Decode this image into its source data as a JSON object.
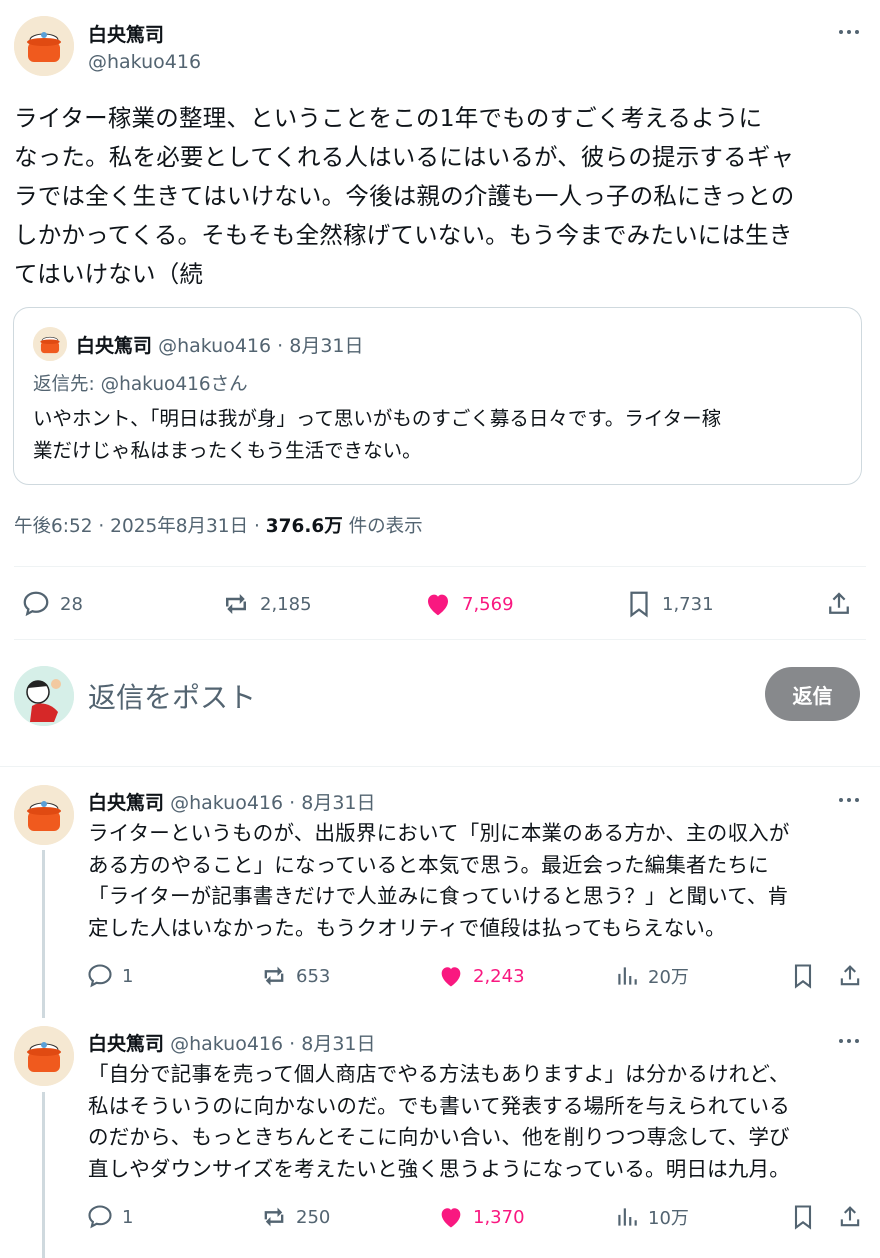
{
  "colors": {
    "like": "#f91880",
    "muted": "#536471",
    "border": "#cfd9de",
    "reply_button_bg": "#87898c"
  },
  "main_post": {
    "author_name": "白央篤司",
    "author_handle": "@hakuo416",
    "text_lines": [
      "ライター稼業の整理、ということをこの1年でものすごく考えるように",
      "なった。私を必要としてくれる人はいるにはいるが、彼らの提示するギャ",
      "ラでは全く生きてはいけない。今後は親の介護も一人っ子の私にきっとの",
      "しかかってくる。そもそも全然稼げていない。もう今までみたいには生き",
      "てはいけない（続"
    ],
    "quote": {
      "author_name": "白央篤司",
      "author_handle": "@hakuo416",
      "date": "· 8月31日",
      "reply_to": "返信先: @hakuo416さん",
      "text_lines": [
        "いやホント、「明日は我が身」って思いがものすごく募る日々です。ライター稼",
        "業だけじゃ私はまったくもう生活できない。"
      ]
    },
    "meta_time": "午後6:52 · 2025年8月31日 · ",
    "meta_views": "376.6万",
    "meta_views_label": " 件の表示",
    "actions": {
      "replies": "28",
      "reposts": "2,185",
      "likes": "7,569",
      "bookmarks": "1,731"
    }
  },
  "compose": {
    "placeholder": "返信をポスト",
    "button_label": "返信"
  },
  "replies": [
    {
      "author_name": "白央篤司",
      "author_handle": "@hakuo416",
      "date": "· 8月31日",
      "text_lines": [
        "ライターというものが、出版界において「別に本業のある方か、主の収入が",
        "ある方のやること」になっていると本気で思う。最近会った編集者たちに",
        "「ライターが記事書きだけで人並みに食っていけると思う？」と聞いて、肯",
        "定した人はいなかった。もうクオリティで値段は払ってもらえない。"
      ],
      "actions": {
        "replies": "1",
        "reposts": "653",
        "likes": "2,243",
        "views": "20万"
      }
    },
    {
      "author_name": "白央篤司",
      "author_handle": "@hakuo416",
      "date": "· 8月31日",
      "text_lines": [
        "「自分で記事を売って個人商店でやる方法もありますよ」は分かるけれど、",
        "私はそういうのに向かないのだ。でも書いて発表する場所を与えられている",
        "のだから、もっときちんとそこに向かい合い、他を削りつつ専念して、学び",
        "直しやダウンサイズを考えたいと強く思うようになっている。明日は九月。"
      ],
      "actions": {
        "replies": "1",
        "reposts": "250",
        "likes": "1,370",
        "views": "10万"
      }
    }
  ]
}
